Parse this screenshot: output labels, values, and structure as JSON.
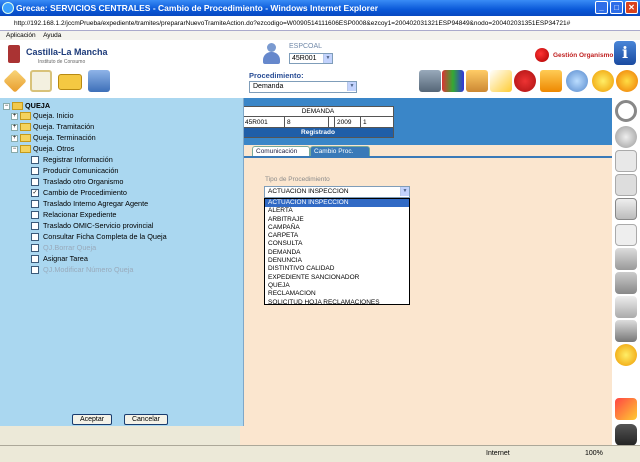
{
  "window": {
    "title": "Grecae: SERVICIOS CENTRALES - Cambio de Procedimiento - Windows Internet Explorer"
  },
  "address": {
    "url": "http://192.168.1.2/jccmPrueba/expediente/tramites/prepararNuevoTramiteAction.do?ezcodigo=W0090514111606ESP0008&ezcoy1=200402031321ESP94849&nodo=200402031351ESP34721#"
  },
  "menubar": {
    "items": [
      "Aplicación",
      "Ayuda"
    ]
  },
  "header": {
    "logo_title": "Castilla-La Mancha",
    "logo_sub": "Instituto de Consumo",
    "user_label": "ESPCOAL",
    "user_select": "45R001",
    "gestion": "Gestión Organismo"
  },
  "toolbar": {
    "procedimiento_label": "Procedimiento:",
    "procedimiento_value": "Demanda"
  },
  "expediente": {
    "title": "DEMANDA",
    "fields": [
      "45R001",
      "8",
      "",
      "2009",
      "1"
    ],
    "status": "Registrado"
  },
  "tree": {
    "root": "QUEJA",
    "folders": [
      "Queja. Inicio",
      "Queja. Tramitación",
      "Queja. Terminación",
      "Queja. Otros"
    ],
    "items": [
      {
        "label": "Registrar Información",
        "checked": false,
        "disabled": false
      },
      {
        "label": "Producir Comunicación",
        "checked": false,
        "disabled": false
      },
      {
        "label": "Traslado otro Organismo",
        "checked": false,
        "disabled": false
      },
      {
        "label": "Cambio de Procedimiento",
        "checked": true,
        "disabled": false
      },
      {
        "label": "Traslado Interno Agregar Agente",
        "checked": false,
        "disabled": false
      },
      {
        "label": "Relacionar Expediente",
        "checked": false,
        "disabled": false
      },
      {
        "label": "Traslado OMIC-Servicio provincial",
        "checked": false,
        "disabled": false
      },
      {
        "label": "Consultar Ficha Completa de la Queja",
        "checked": false,
        "disabled": false
      },
      {
        "label": "QJ.Borrar Queja",
        "checked": false,
        "disabled": true
      },
      {
        "label": "Asignar Tarea",
        "checked": false,
        "disabled": false
      },
      {
        "label": "QJ.Modificar Número Queja",
        "checked": false,
        "disabled": true
      }
    ]
  },
  "buttons": {
    "accept": "Aceptar",
    "cancel": "Cancelar"
  },
  "tabs": [
    "Comunicación",
    "Cambio Proc."
  ],
  "form": {
    "tipo_label": "Tipo de Procedimiento",
    "tipo_value": "ACTUACION INSPECCION",
    "options": [
      "ACTUACION INSPECCION",
      "ALERTA",
      "ARBITRAJE",
      "CAMPAÑA",
      "CARPETA",
      "CONSULTA",
      "DEMANDA",
      "DENUNCIA",
      "DISTINTIVO CALIDAD",
      "EXPEDIENTE SANCIONADOR",
      "QUEJA",
      "RECLAMACION",
      "SOLICITUD HOJA RECLAMACIONES"
    ]
  },
  "statusbar": {
    "zone": "Internet",
    "zoom": "100%"
  }
}
